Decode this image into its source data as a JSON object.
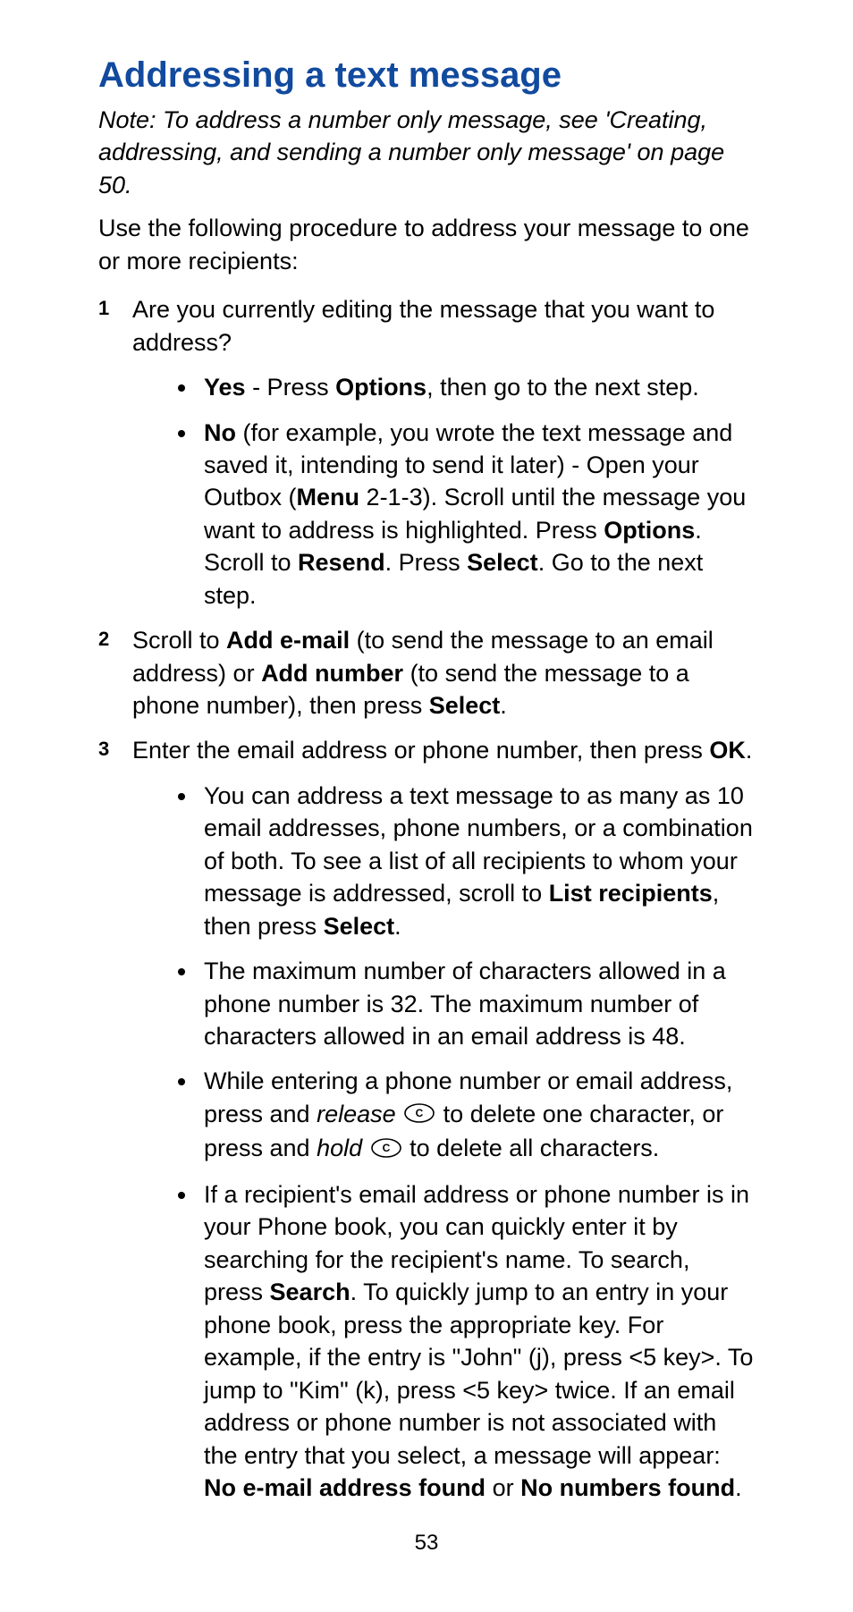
{
  "title": "Addressing a text message",
  "note": "Note: To address a number only message, see 'Creating, addressing, and sending a number only message' on page 50.",
  "intro": "Use the following procedure to address your message to one or more recipients:",
  "step1": {
    "text": "Are you currently editing the message that you want to address?",
    "yes": {
      "label": "Yes",
      "pre": " - Press ",
      "opt": "Options",
      "post": ", then go to the next step."
    },
    "no": {
      "label": "No",
      "p1": " (for example, you wrote the text message and saved it, intending to send it later) - Open your Outbox (",
      "menu": "Menu",
      "p2": " 2-1-3). Scroll until the message you want to address is highlighted. Press ",
      "opt": "Options",
      "p3": ". Scroll to ",
      "resend": "Resend",
      "p4": ". Press ",
      "select": "Select",
      "p5": ". Go to the next step."
    }
  },
  "step2": {
    "p1": "Scroll to ",
    "addEmail": "Add e-mail",
    "p2": " (to send the message to an email address) or ",
    "addNumber": "Add number",
    "p3": " (to send the message to a phone number), then press ",
    "select": "Select",
    "p4": "."
  },
  "step3": {
    "p1": "Enter the email address or phone number, then press ",
    "ok": "OK",
    "p2": ".",
    "b1": {
      "p1": "You can address a text message to as many as 10 email addresses, phone numbers, or a combination of both. To see a list of all recipients to whom your message is addressed, scroll to ",
      "list": "List recipients",
      "p2": ", then press ",
      "select": "Select",
      "p3": "."
    },
    "b2": "The maximum number of characters allowed in a phone number is 32. The maximum number of characters allowed in an email address is 48.",
    "b3": {
      "p1": "While entering a phone number or email address, press and ",
      "rel": "release",
      "p2": " to delete one character, or press and ",
      "hold": "hold",
      "p3": " to delete all characters."
    },
    "b4": {
      "p1": "If a recipient's email address or phone number is in your Phone book, you can quickly enter it by searching for the recipient's name. To search, press ",
      "search": "Search",
      "p2": ". To quickly jump to an entry in your phone book, press the appropriate key. For example, if the entry is \"John\" (j), press <5 key>. To jump to \"Kim\" (k), press <5 key> twice. If an email address or phone number is not associated with the entry that you select, a message will appear: ",
      "noEmail": "No e-mail address found",
      "or": " or ",
      "noNum": "No numbers found",
      "p3": "."
    }
  },
  "pageNumber": "53"
}
